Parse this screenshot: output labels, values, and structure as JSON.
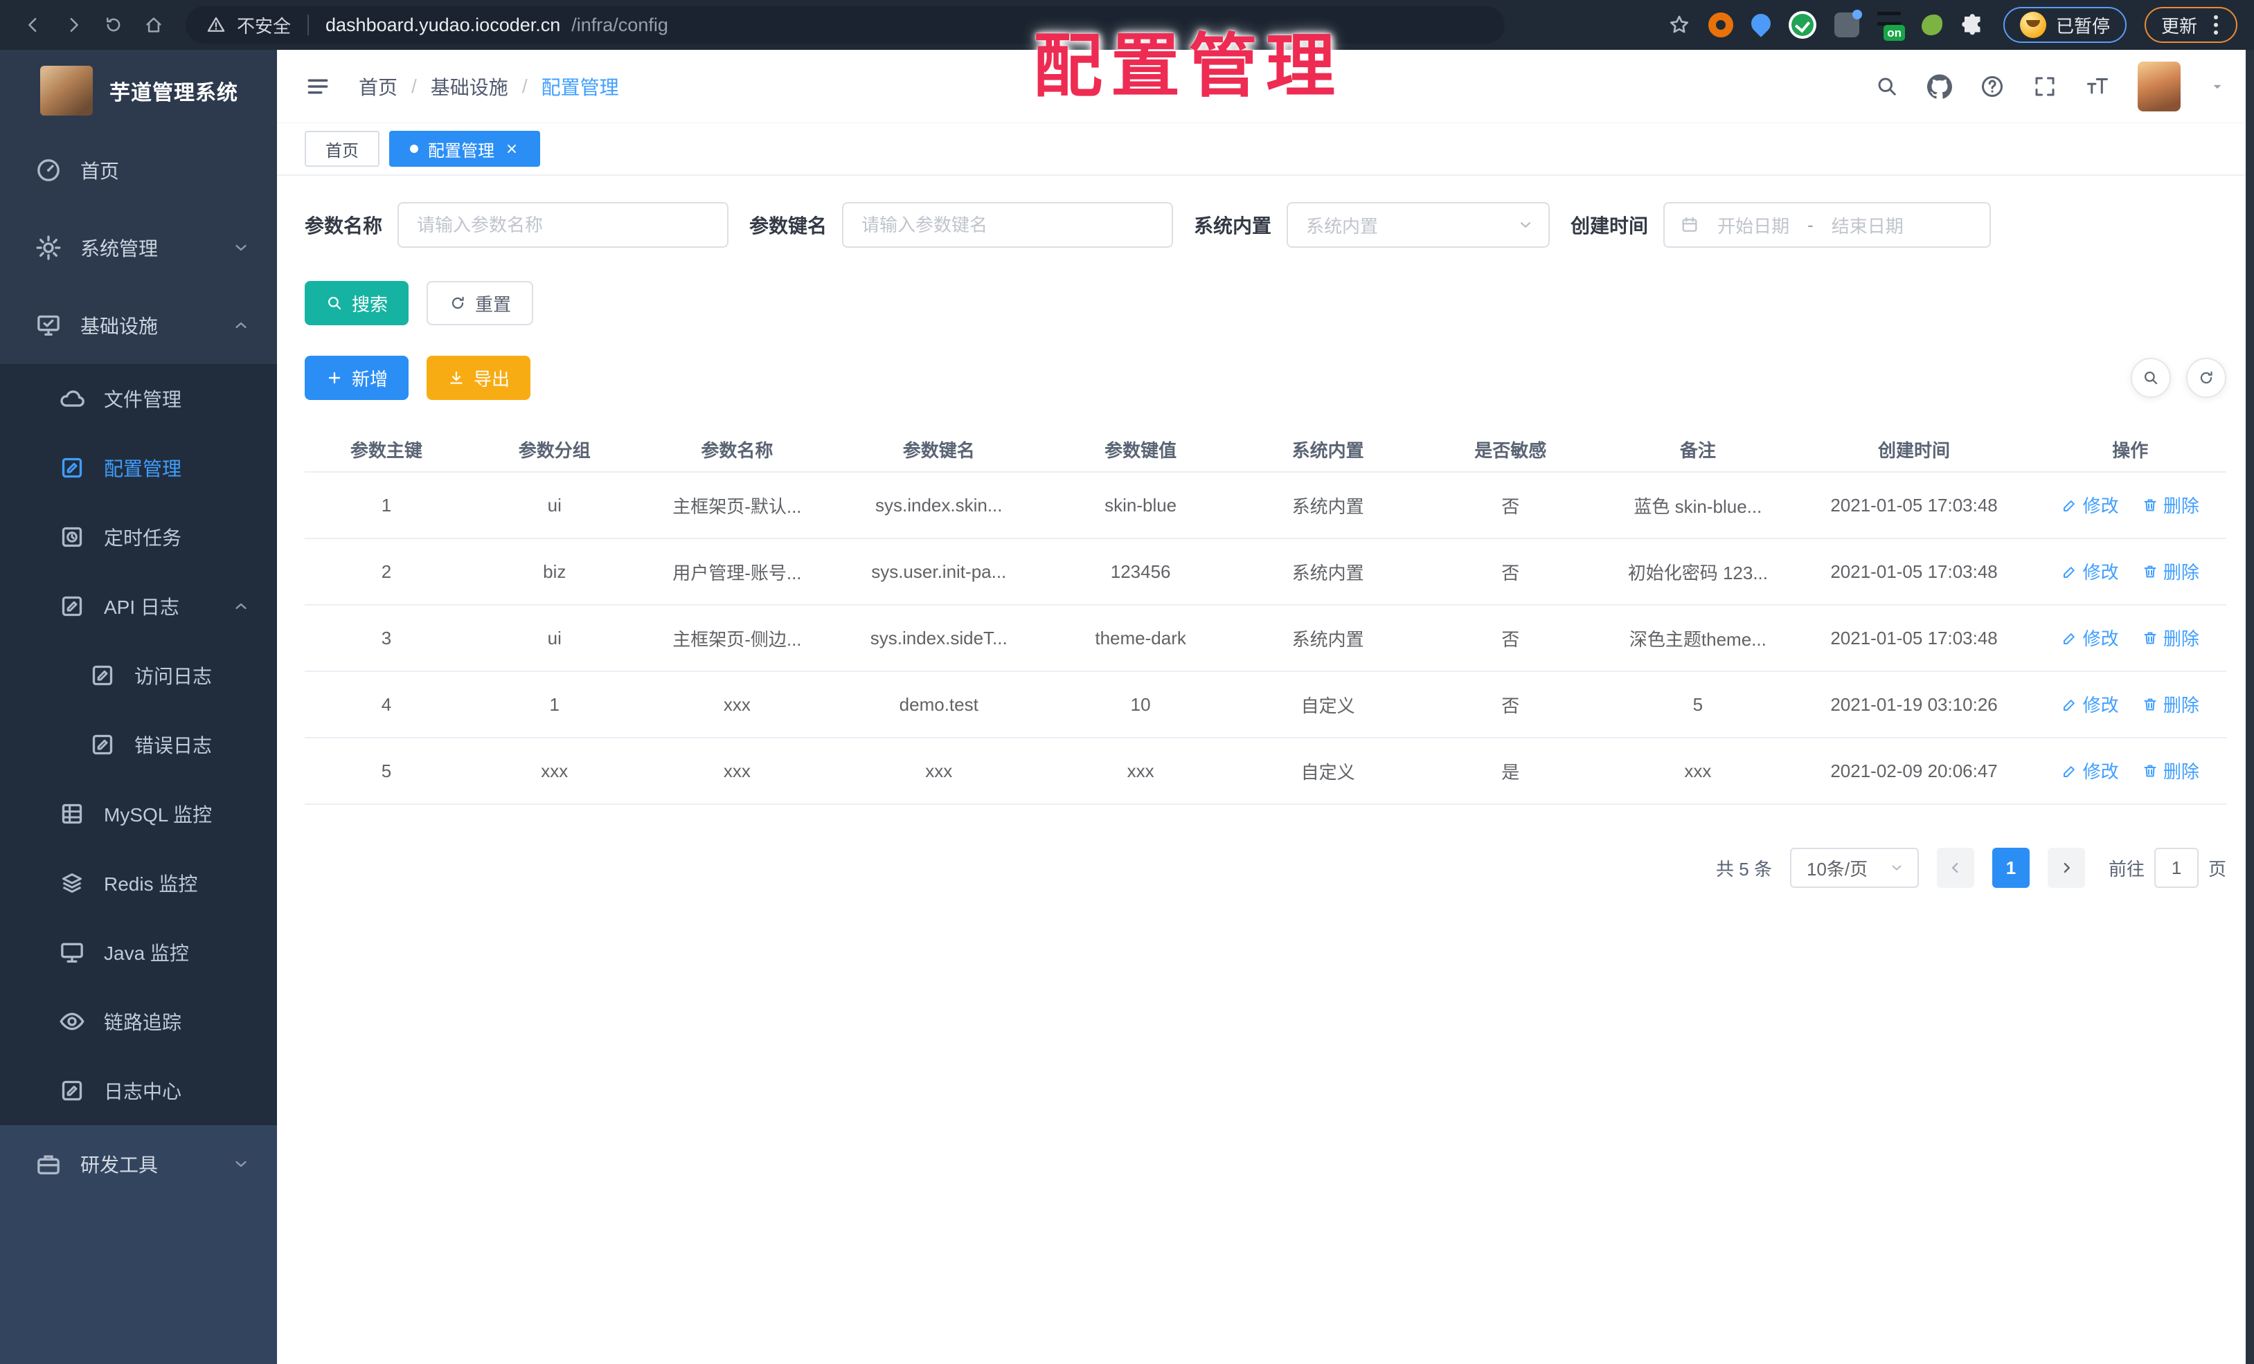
{
  "annotation": {
    "text": "配置管理"
  },
  "browser": {
    "security_label": "不安全",
    "url_host": "dashboard.yudao.iocoder.cn",
    "url_path": "/infra/config",
    "ext_badge": "on",
    "paused_badge": "已暂停",
    "update_button": "更新"
  },
  "sidebar": {
    "app_title": "芋道管理系统",
    "items": [
      {
        "label": "首页"
      },
      {
        "label": "系统管理"
      },
      {
        "label": "基础设施"
      },
      {
        "label": "文件管理"
      },
      {
        "label": "配置管理"
      },
      {
        "label": "定时任务"
      },
      {
        "label": "API 日志"
      },
      {
        "label": "访问日志"
      },
      {
        "label": "错误日志"
      },
      {
        "label": "MySQL 监控"
      },
      {
        "label": "Redis 监控"
      },
      {
        "label": "Java 监控"
      },
      {
        "label": "链路追踪"
      },
      {
        "label": "日志中心"
      },
      {
        "label": "研发工具"
      }
    ]
  },
  "header": {
    "breadcrumb": [
      "首页",
      "基础设施",
      "配置管理"
    ]
  },
  "tabs": [
    {
      "label": "首页"
    },
    {
      "label": "配置管理"
    }
  ],
  "filters": {
    "name_label": "参数名称",
    "name_placeholder": "请输入参数名称",
    "key_label": "参数键名",
    "key_placeholder": "请输入参数键名",
    "type_label": "系统内置",
    "type_placeholder": "系统内置",
    "date_label": "创建时间",
    "date_start_placeholder": "开始日期",
    "date_range_separator": "-",
    "date_end_placeholder": "结束日期"
  },
  "toolbar": {
    "search": "搜索",
    "reset": "重置",
    "add": "新增",
    "export": "导出"
  },
  "table": {
    "columns": [
      "参数主键",
      "参数分组",
      "参数名称",
      "参数键名",
      "参数键值",
      "系统内置",
      "是否敏感",
      "备注",
      "创建时间",
      "操作"
    ],
    "rows": [
      [
        "1",
        "ui",
        "主框架页-默认...",
        "sys.index.skin...",
        "skin-blue",
        "系统内置",
        "否",
        "蓝色 skin-blue...",
        "2021-01-05 17:03:48"
      ],
      [
        "2",
        "biz",
        "用户管理-账号...",
        "sys.user.init-pa...",
        "123456",
        "系统内置",
        "否",
        "初始化密码 123...",
        "2021-01-05 17:03:48"
      ],
      [
        "3",
        "ui",
        "主框架页-侧边...",
        "sys.index.sideT...",
        "theme-dark",
        "系统内置",
        "否",
        "深色主题theme...",
        "2021-01-05 17:03:48"
      ],
      [
        "4",
        "1",
        "xxx",
        "demo.test",
        "10",
        "自定义",
        "否",
        "5",
        "2021-01-19 03:10:26"
      ],
      [
        "5",
        "xxx",
        "xxx",
        "xxx",
        "xxx",
        "自定义",
        "是",
        "xxx",
        "2021-02-09 20:06:47"
      ]
    ],
    "actions": {
      "edit": "修改",
      "delete": "删除"
    }
  },
  "pagination": {
    "total": "共 5 条",
    "page_size": "10条/页",
    "current_page": "1",
    "goto_label": "前往",
    "goto_value": "1",
    "page_unit": "页"
  }
}
